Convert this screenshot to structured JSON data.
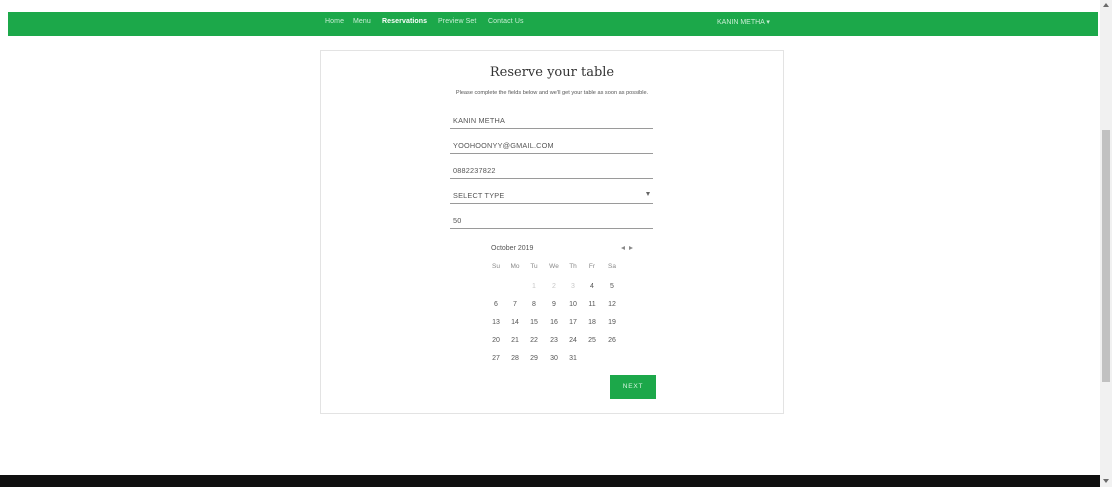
{
  "nav": {
    "items": [
      {
        "label": "Home",
        "active": false
      },
      {
        "label": "Menu",
        "active": false
      },
      {
        "label": "Reservations",
        "active": true
      },
      {
        "label": "Preview Set",
        "active": false
      },
      {
        "label": "Contact Us",
        "active": false
      }
    ],
    "user_label": "KANIN METHA ▾"
  },
  "form": {
    "title": "Reserve your table",
    "subtitle": "Please complete the fields below and we'll get your table as soon as possible.",
    "name_value": "KANIN METHA",
    "email_value": "YOOHOONYY@GMAIL.COM",
    "phone_value": "0882237822",
    "type_value": "SELECT TYPE",
    "guests_value": "50",
    "next_label": "NEXT"
  },
  "calendar": {
    "month_label": "October 2019",
    "weekdays": [
      "Su",
      "Mo",
      "Tu",
      "We",
      "Th",
      "Fr",
      "Sa"
    ],
    "weeks": [
      [
        "",
        "",
        "1",
        "2",
        "3",
        "4",
        "5"
      ],
      [
        "6",
        "7",
        "8",
        "9",
        "10",
        "11",
        "12"
      ],
      [
        "13",
        "14",
        "15",
        "16",
        "17",
        "18",
        "19"
      ],
      [
        "20",
        "21",
        "22",
        "23",
        "24",
        "25",
        "26"
      ],
      [
        "27",
        "28",
        "29",
        "30",
        "31",
        "",
        ""
      ]
    ],
    "disabled_days": [
      "1",
      "2",
      "3"
    ]
  },
  "colors": {
    "brand_green": "#1ca84a",
    "footer": "#101010"
  }
}
